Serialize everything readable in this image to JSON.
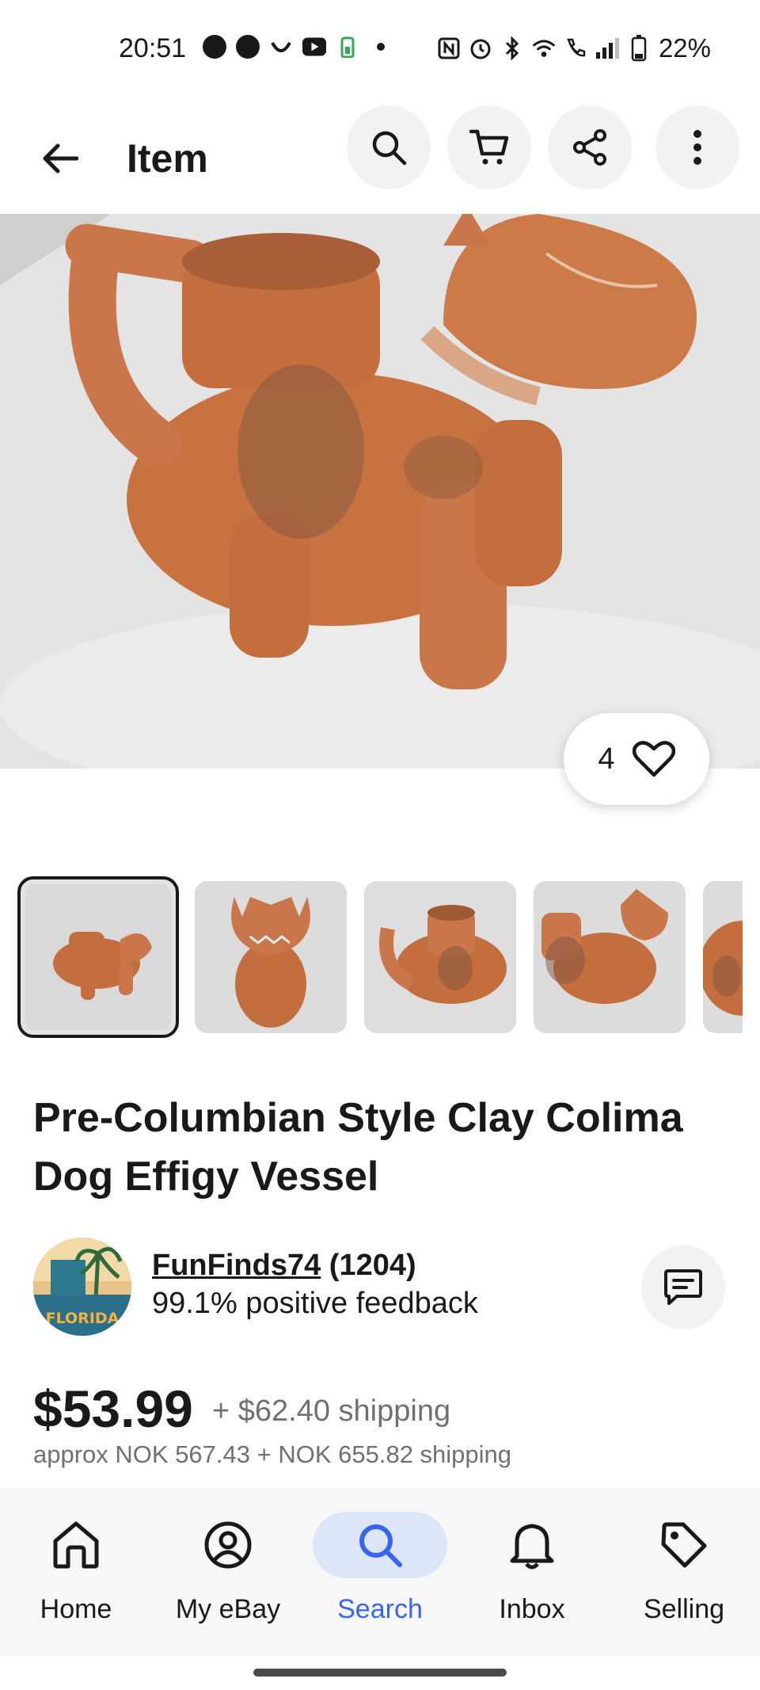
{
  "status_bar": {
    "time": "20:51",
    "battery": "22%"
  },
  "header": {
    "title": "Item",
    "back_icon": "back-arrow-icon",
    "actions": [
      "search-icon",
      "cart-icon",
      "share-icon",
      "more-vertical-icon"
    ]
  },
  "hero": {
    "likes": "4",
    "like_icon": "heart-icon"
  },
  "thumbnails": {
    "selected_index": 0
  },
  "product": {
    "title": "Pre-Columbian Style Clay Colima Dog Effigy Vessel"
  },
  "seller": {
    "name": "FunFinds74",
    "count": "(1204)",
    "feedback": "99.1% positive feedback",
    "avatar_text": "FLORIDA"
  },
  "price": {
    "main": "$53.99",
    "shipping": "+ $62.40 shipping",
    "approx": "approx NOK 567.43 + NOK 655.82 shipping"
  },
  "bottom_nav": {
    "items": [
      {
        "label": "Home",
        "icon": "home-icon"
      },
      {
        "label": "My eBay",
        "icon": "user-circle-icon"
      },
      {
        "label": "Search",
        "icon": "search-icon"
      },
      {
        "label": "Inbox",
        "icon": "bell-icon"
      },
      {
        "label": "Selling",
        "icon": "tag-icon"
      }
    ],
    "active": "Search"
  },
  "colors": {
    "accent": "#3665f3",
    "active_pill": "#dbe7f7",
    "text": "#191919",
    "muted": "#707070",
    "terracotta": "#c9774a"
  }
}
